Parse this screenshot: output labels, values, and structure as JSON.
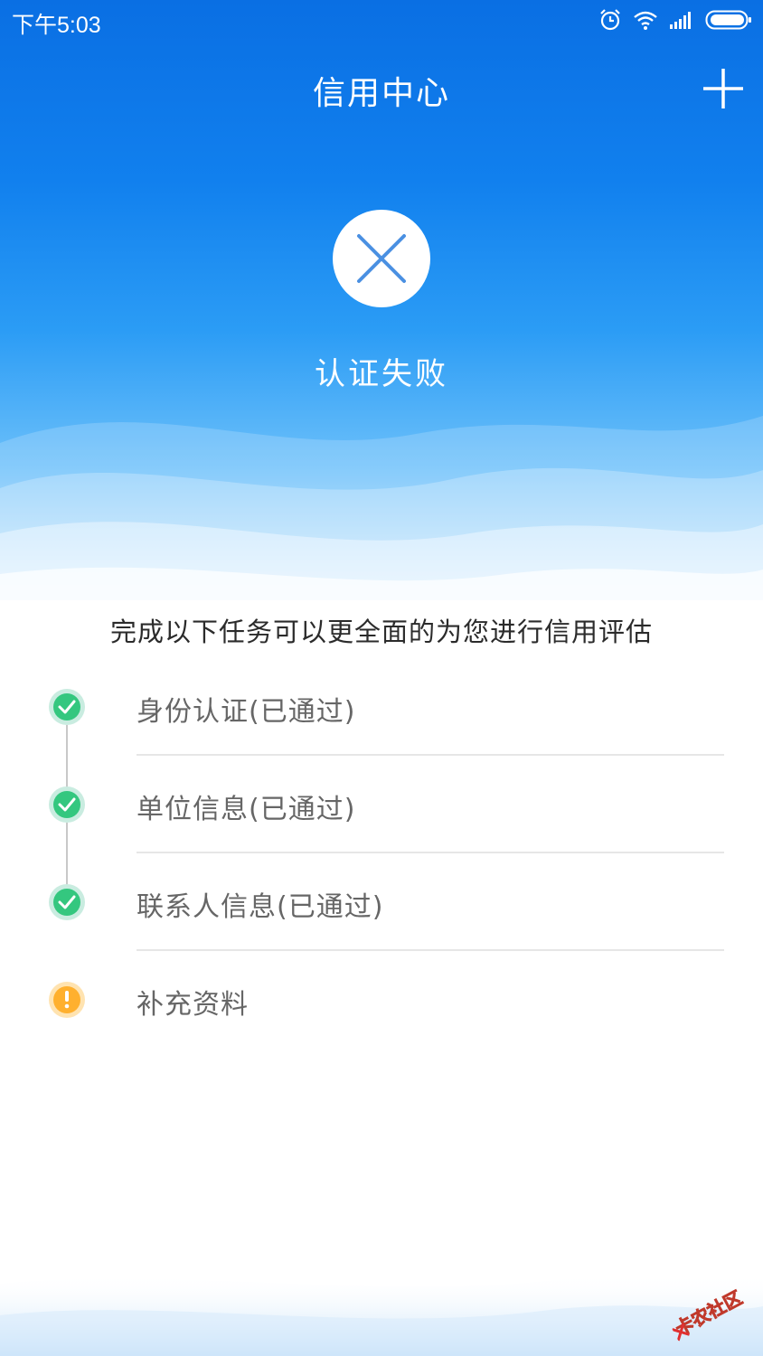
{
  "status_bar": {
    "time": "下午5:03",
    "icons": [
      "alarm-icon",
      "wifi-icon",
      "signal-icon",
      "battery-icon"
    ]
  },
  "header": {
    "title": "信用中心",
    "add_icon": "plus-icon"
  },
  "result": {
    "icon": "close-icon",
    "label": "认证失败"
  },
  "intro_text": "完成以下任务可以更全面的为您进行信用评估",
  "tasks": [
    {
      "label": "身份认证(已通过)",
      "status": "passed",
      "icon": "check-icon"
    },
    {
      "label": "单位信息(已通过)",
      "status": "passed",
      "icon": "check-icon"
    },
    {
      "label": "联系人信息(已通过)",
      "status": "passed",
      "icon": "check-icon"
    },
    {
      "label": "补充资料",
      "status": "pending",
      "icon": "exclamation-icon"
    }
  ],
  "watermark": "卡农社区",
  "colors": {
    "hero_top": "#0a6fe3",
    "success": "#34c77f",
    "warning": "#ffb02e",
    "x_mark": "#4a90e2"
  }
}
